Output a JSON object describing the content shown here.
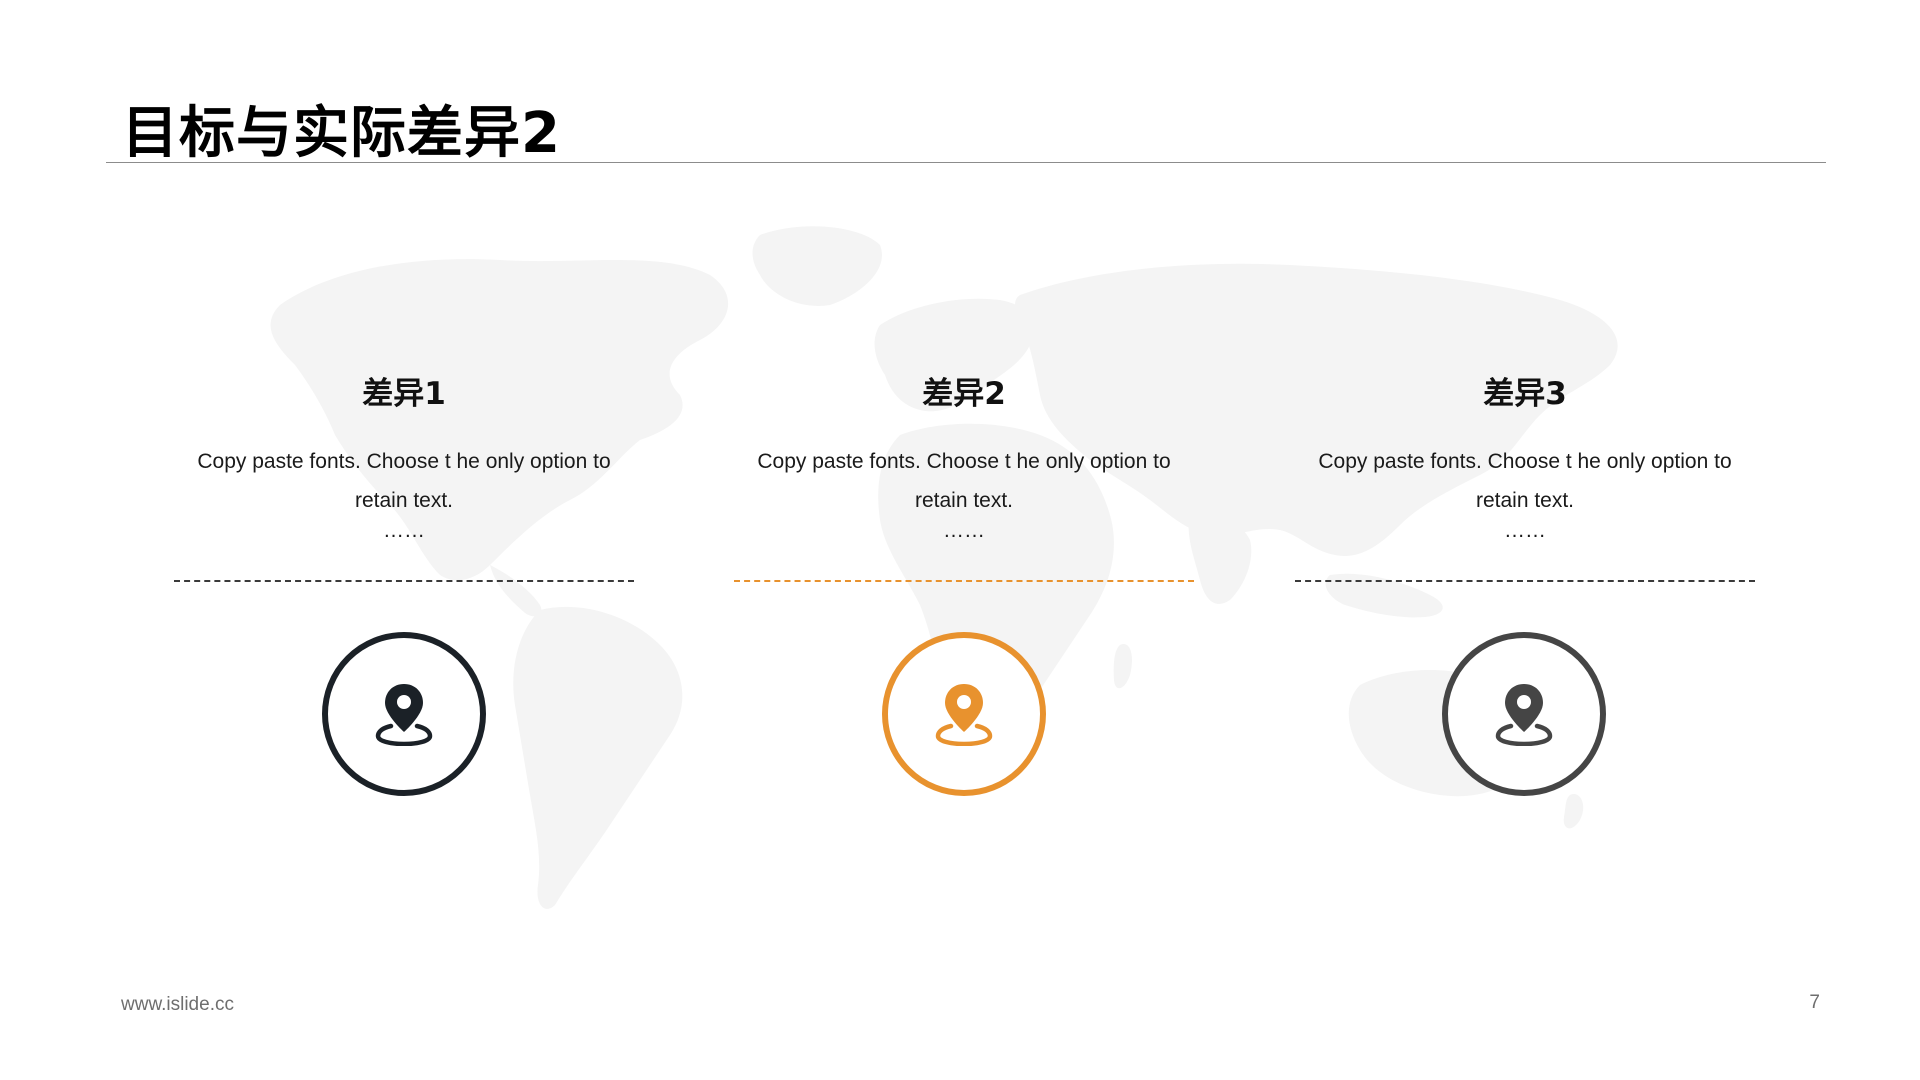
{
  "slide": {
    "title": "目标与实际差异2"
  },
  "columns": [
    {
      "heading": "差异1",
      "body": "Copy paste fonts. Choose t he only option to retain text.",
      "ellipsis": "……",
      "icon": "location-pin-icon",
      "color": "#1B2127"
    },
    {
      "heading": "差异2",
      "body": "Copy paste fonts. Choose t he only option to retain text.",
      "ellipsis": "……",
      "icon": "location-pin-icon",
      "color": "#E8922E"
    },
    {
      "heading": "差异3",
      "body": "Copy paste fonts. Choose t he only option to retain text.",
      "ellipsis": "……",
      "icon": "location-pin-icon",
      "color": "#454545"
    }
  ],
  "footer": {
    "url": "www.islide.cc",
    "page_number": "7"
  },
  "colors": {
    "accent": "#E8922E",
    "dark": "#1B2127",
    "gray": "#454545",
    "map": "#F4F4F4"
  }
}
